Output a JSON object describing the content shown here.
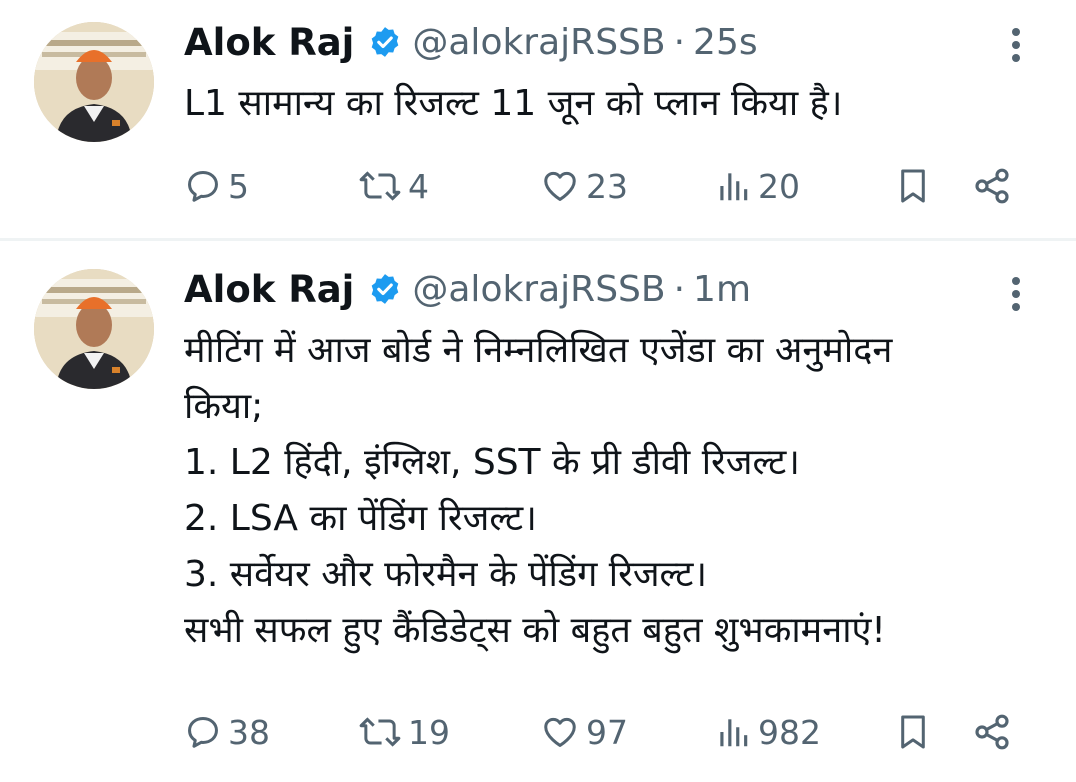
{
  "colors": {
    "text": "#0f1419",
    "secondary": "#536471",
    "verified": "#1d9bf0",
    "divider": "#eff3f4"
  },
  "icons": [
    "verified-badge-icon",
    "more-icon",
    "reply-icon",
    "retweet-icon",
    "like-icon",
    "views-icon",
    "bookmark-icon",
    "share-icon"
  ],
  "tweets": [
    {
      "name": "Alok Raj",
      "handle": "@alokrajRSSB",
      "separator": "·",
      "time": "25s",
      "text": "L1 सामान्य का रिजल्ट 11 जून को प्लान किया है।",
      "replies": "5",
      "retweets": "4",
      "likes": "23",
      "views": "20"
    },
    {
      "name": "Alok Raj",
      "handle": "@alokrajRSSB",
      "separator": "·",
      "time": "1m",
      "text": "मीटिंग में आज बोर्ड ने निम्नलिखित एजेंडा का अनुमोदन\nकिया;\n1. L2 हिंदी, इंग्लिश, SST के प्री डीवी रिजल्ट।\n2. LSA का पेंडिंग रिजल्ट।\n3. सर्वेयर और फोरमैन के पेंडिंग रिजल्ट।\nसभी सफल हुए कैंडिडेट्स को बहुत बहुत शुभकामनाएं!",
      "replies": "38",
      "retweets": "19",
      "likes": "97",
      "views": "982"
    }
  ]
}
